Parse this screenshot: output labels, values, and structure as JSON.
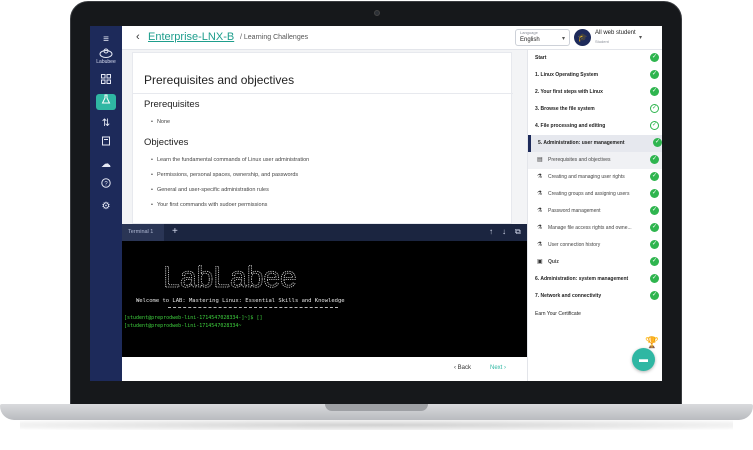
{
  "header": {
    "back_icon": "chevron-left-icon",
    "course": "Enterprise-LNX-B",
    "crumb": "/ Learning Challenges",
    "language_label": "Language",
    "language": "English",
    "user_name": "All web student",
    "user_role": "Student"
  },
  "rail": {
    "logo_label": "Labubee",
    "icons": [
      "menu-icon",
      "logo-icon",
      "dashboard-icon",
      "lab-flask-icon",
      "sort-icon",
      "book-icon",
      "cloud-icon",
      "help-icon",
      "settings-icon"
    ]
  },
  "content": {
    "title": "Prerequisites and objectives",
    "prereq_heading": "Prerequisites",
    "prereq_items": [
      "None"
    ],
    "objectives_heading": "Objectives",
    "objectives_items": [
      "Learn the fundamental commands of Linux user administration",
      "Permissions, personal spaces, ownership, and passwords",
      "General and user-specific administration rules",
      "Your first commands with sudoer permissions"
    ]
  },
  "terminal": {
    "tab_label": "Terminal 1",
    "ascii_banner": "LabLabee",
    "welcome": "Welcome to LAB: Mastering Linux: Essential Skills and Knowledge",
    "prompt1": "[student@preprodweb-lini-1714547028334-]~]$ []",
    "prompt2": "[student@preprodweb-lini-1714547028334~"
  },
  "nav": {
    "back": "Back",
    "next": "Next"
  },
  "outline": {
    "items": [
      {
        "label": "Start",
        "bold": true,
        "sub": false,
        "state": "done"
      },
      {
        "label": "1. Linux Operating System",
        "bold": true,
        "sub": false,
        "state": "done"
      },
      {
        "label": "2. Your first steps with Linux",
        "bold": true,
        "sub": false,
        "state": "done"
      },
      {
        "label": "3. Browse the file system",
        "bold": true,
        "sub": false,
        "state": "partial"
      },
      {
        "label": "4. File processing and editing",
        "bold": true,
        "sub": false,
        "state": "partial"
      },
      {
        "label": "5. Administration: user management",
        "bold": true,
        "sub": false,
        "state": "done"
      },
      {
        "label": "Prerequisites and objectives",
        "bold": false,
        "sub": true,
        "state": "done"
      },
      {
        "label": "Creating and managing user rights",
        "bold": false,
        "sub": true,
        "state": "done"
      },
      {
        "label": "Creating groups and assigning users",
        "bold": false,
        "sub": true,
        "state": "done"
      },
      {
        "label": "Password management",
        "bold": false,
        "sub": true,
        "state": "done"
      },
      {
        "label": "Manage file access rights and owne...",
        "bold": false,
        "sub": true,
        "state": "done"
      },
      {
        "label": "User connection history",
        "bold": false,
        "sub": true,
        "state": "done"
      },
      {
        "label": "Quiz",
        "bold": true,
        "sub": true,
        "state": "done"
      },
      {
        "label": "6. Administration: system management",
        "bold": true,
        "sub": false,
        "state": "done"
      },
      {
        "label": "7. Network and connectivity",
        "bold": true,
        "sub": false,
        "state": "done"
      },
      {
        "label": "Earn Your Certificate",
        "bold": false,
        "sub": false,
        "state": "trophy"
      }
    ]
  },
  "colors": {
    "accent": "#2fb7a3",
    "rail": "#1d2a5a",
    "check": "#2fb54f"
  }
}
